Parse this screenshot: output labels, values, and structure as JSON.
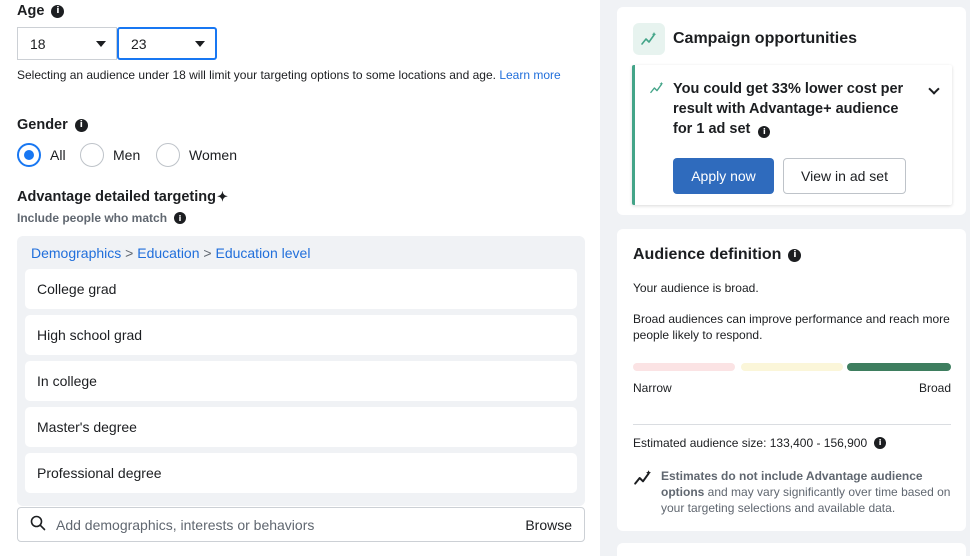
{
  "age": {
    "label": "Age",
    "min_value": "18",
    "max_value": "23",
    "note": "Selecting an audience under 18 will limit your targeting options to some locations and age.",
    "learn_more": "Learn more"
  },
  "gender": {
    "label": "Gender",
    "options": [
      {
        "label": "All",
        "selected": true
      },
      {
        "label": "Men",
        "selected": false
      },
      {
        "label": "Women",
        "selected": false
      }
    ]
  },
  "targeting": {
    "title": "Advantage detailed targeting",
    "title_mark": "✦",
    "subtitle": "Include people who match",
    "breadcrumb": [
      "Demographics",
      "Education",
      "Education level"
    ],
    "breadcrumb_sep": ">",
    "items": [
      "College grad",
      "High school grad",
      "In college",
      "Master's degree",
      "Professional degree"
    ],
    "search_placeholder": "Add demographics, interests or behaviors",
    "browse_label": "Browse"
  },
  "opportunities": {
    "title": "Campaign opportunities",
    "message": "You could get 33% lower cost per result with Advantage+ audience for 1 ad set",
    "apply_label": "Apply now",
    "view_label": "View in ad set",
    "accent_color": "#43a488"
  },
  "audience": {
    "title": "Audience definition",
    "status": "Your audience is broad.",
    "description": "Broad audiences can improve performance and reach more people likely to respond.",
    "meter_low_label": "Narrow",
    "meter_high_label": "Broad",
    "meter_level": "broad",
    "estimate": "Estimated audience size: 133,400 - 156,900",
    "note_bold": "Estimates do not include Advantage audience options",
    "note_rest": " and may vary significantly over time based on your targeting selections and available data.",
    "colors": {
      "narrow": "#fbe3e4",
      "mid": "#fbf6d9",
      "broad": "#3e7e5f"
    }
  }
}
